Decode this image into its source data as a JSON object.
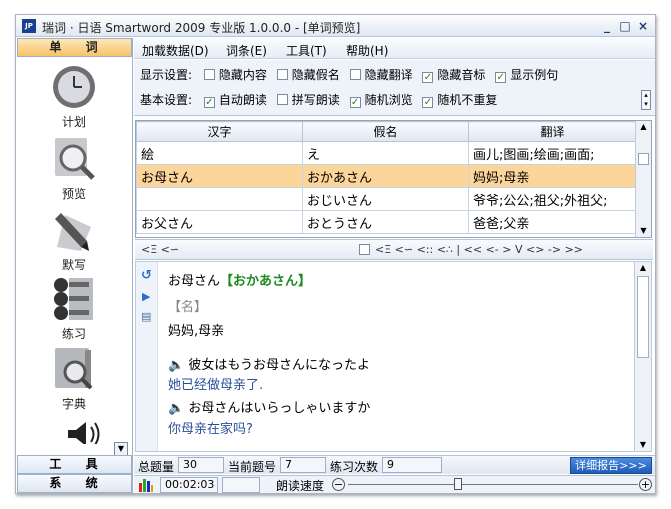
{
  "window": {
    "title": "瑞词 · 日语 Smartword 2009 专业版 1.0.0.0 - [单词预览]",
    "icon_label": "JP"
  },
  "sidebar": {
    "active_section": "单 词",
    "tools": [
      {
        "label": "计划",
        "icon": "clock-icon"
      },
      {
        "label": "预览",
        "icon": "magnifier-icon"
      },
      {
        "label": "默写",
        "icon": "pen-icon"
      },
      {
        "label": "练习",
        "icon": "practice-icon"
      },
      {
        "label": "字典",
        "icon": "dictionary-icon"
      }
    ],
    "sections": [
      "工 具",
      "系 统"
    ]
  },
  "menu": {
    "items": [
      "加载数据(D)",
      "词条(E)",
      "工具(T)",
      "帮助(H)"
    ]
  },
  "settings": {
    "display_label": "显示设置:",
    "display_options": [
      {
        "label": "隐藏内容",
        "checked": false
      },
      {
        "label": "隐藏假名",
        "checked": false
      },
      {
        "label": "隐藏翻译",
        "checked": false
      },
      {
        "label": "隐藏音标",
        "checked": true
      },
      {
        "label": "显示例句",
        "checked": true
      }
    ],
    "basic_label": "基本设置:",
    "basic_options": [
      {
        "label": "自动朗读",
        "checked": true
      },
      {
        "label": "拼写朗读",
        "checked": false
      },
      {
        "label": "随机浏览",
        "checked": true
      },
      {
        "label": "随机不重复",
        "checked": true
      }
    ]
  },
  "grid": {
    "columns": [
      "汉字",
      "假名",
      "翻译"
    ],
    "rows": [
      {
        "kanji": "絵",
        "kana": "え",
        "translation": "画儿;图画;绘画;画面;"
      },
      {
        "kanji": "お母さん",
        "kana": "おかあさん",
        "translation": "妈妈;母亲",
        "selected": true
      },
      {
        "kanji": "",
        "kana": "おじいさん",
        "translation": "爷爷;公公;祖父;外祖父;"
      },
      {
        "kanji": "お父さん",
        "kana": "おとうさん",
        "translation": "爸爸;父亲"
      }
    ]
  },
  "navbar": {
    "left": "<Ξ <∽",
    "right": "<Ξ <∽ <:: <∴ | << <- > V <> -> >>"
  },
  "detail": {
    "headword": "お母さん",
    "reading": "【おかあさん】",
    "pos": "【名】",
    "meaning": "妈妈,母亲",
    "examples": [
      {
        "jp": "彼女はもうお母さんになったよ",
        "cn": "她已经做母亲了."
      },
      {
        "jp": "お母さんはいらっしゃいますか",
        "cn": "你母亲在家吗?"
      }
    ]
  },
  "status": {
    "total_label": "总题量",
    "total_value": "30",
    "current_label": "当前题号",
    "current_value": "7",
    "practice_label": "练习次数",
    "practice_value": "9",
    "report_button": "详细报告>>>"
  },
  "bottom": {
    "timer": "00:02:03",
    "speed_label": "朗读速度",
    "speed_level": 0.38
  }
}
